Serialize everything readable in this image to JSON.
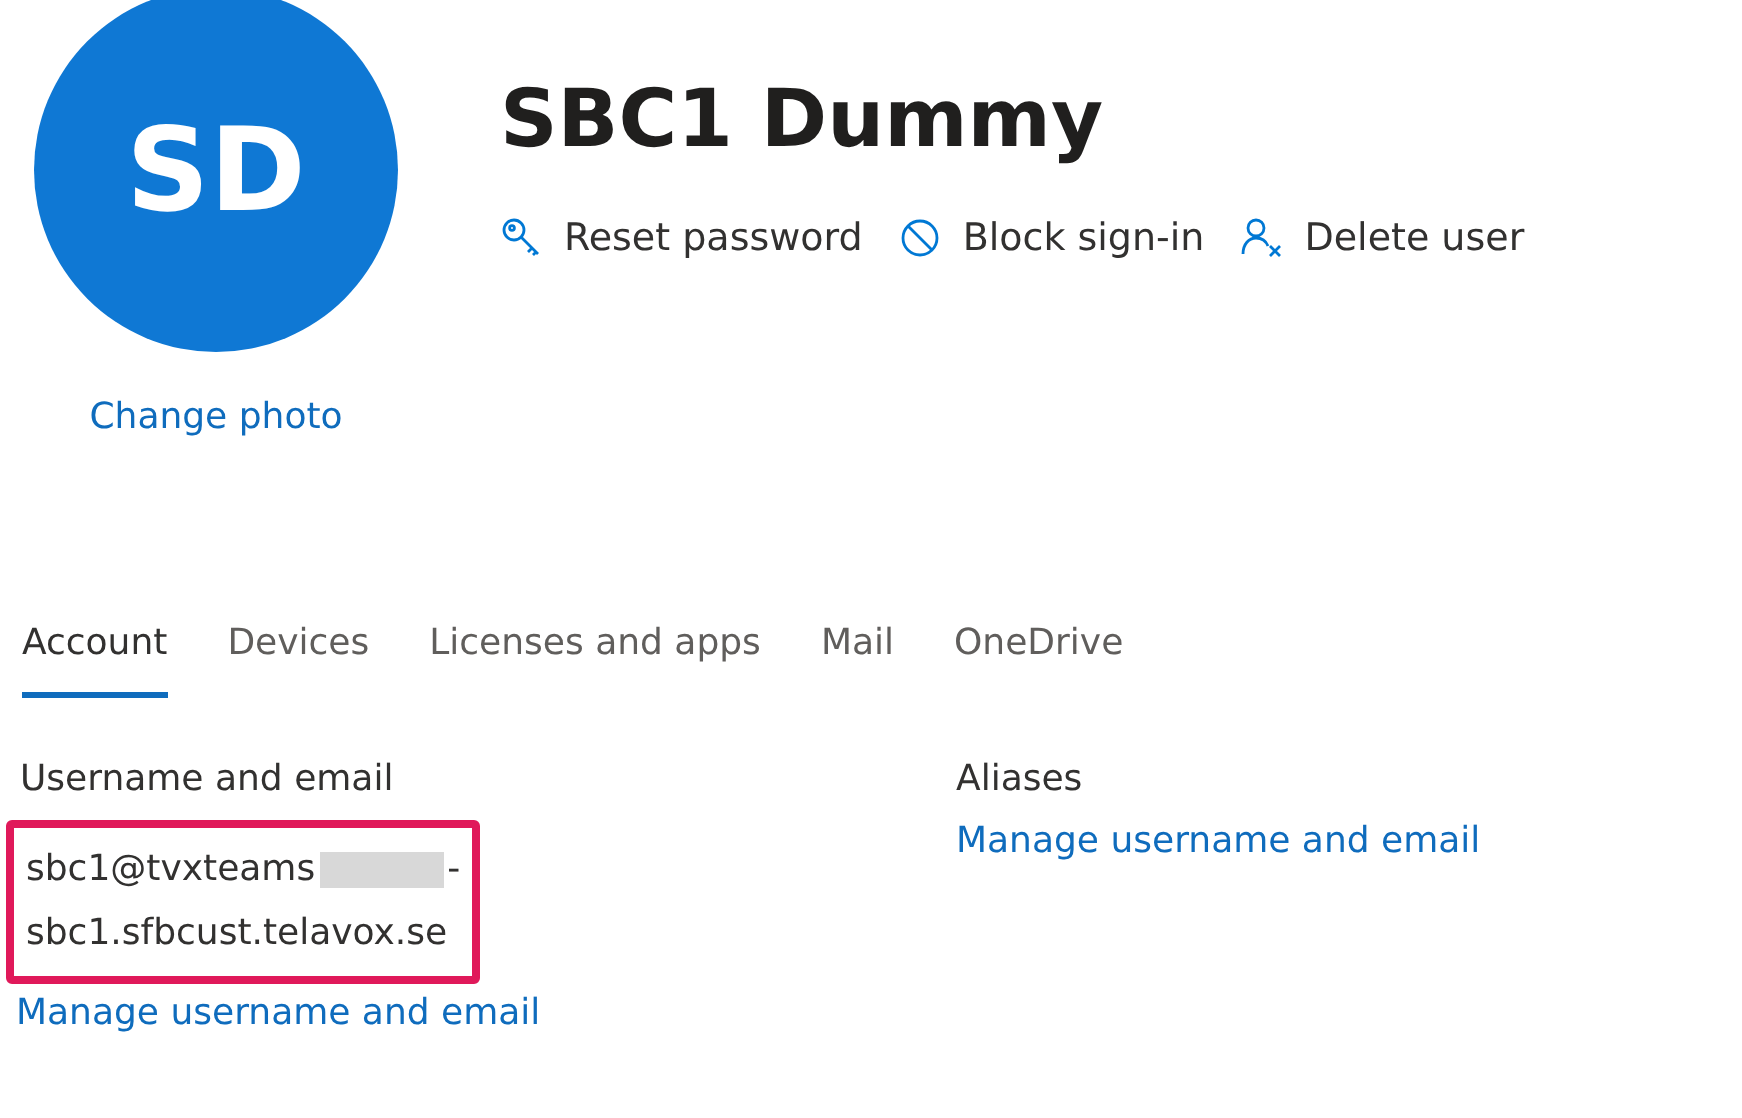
{
  "avatar": {
    "initials": "SD",
    "change_label": "Change photo"
  },
  "user": {
    "name": "SBC1 Dummy"
  },
  "actions": [
    {
      "kind": "key",
      "label": "Reset password"
    },
    {
      "kind": "block",
      "label": "Block sign-in"
    },
    {
      "kind": "delete-user",
      "label": "Delete user"
    }
  ],
  "tabs": [
    {
      "label": "Account",
      "selected": true
    },
    {
      "label": "Devices",
      "selected": false
    },
    {
      "label": "Licenses and apps",
      "selected": false
    },
    {
      "label": "Mail",
      "selected": false
    },
    {
      "label": "OneDrive",
      "selected": false
    }
  ],
  "username_section": {
    "heading": "Username and email",
    "email_start": "sbc1@tvxteams",
    "email_end": "-",
    "email_line2": "sbc1.sfbcust.telavox.se",
    "highlighted": true,
    "link": "Manage username and email"
  },
  "aliases_section": {
    "heading": "Aliases",
    "link": "Manage username and email"
  }
}
